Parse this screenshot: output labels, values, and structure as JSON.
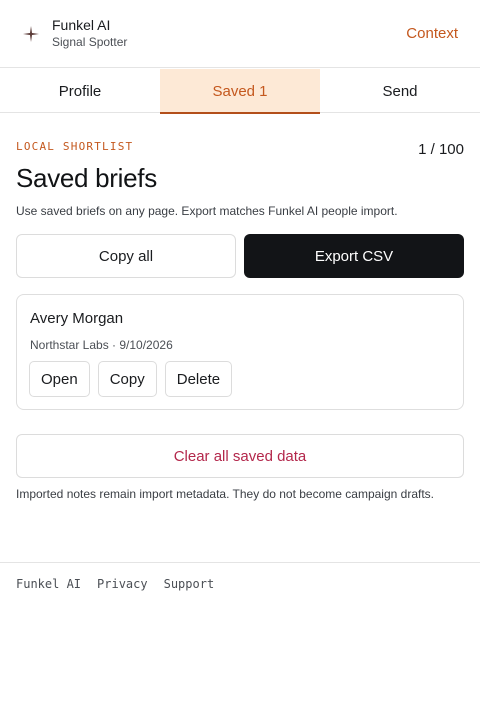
{
  "header": {
    "logo_icon": "sparkle-icon",
    "title": "Funkel AI",
    "subtitle": "Signal Spotter",
    "context_label": "Context",
    "accent_color": "#c4581e"
  },
  "tabs": [
    {
      "label": "Profile",
      "active": false
    },
    {
      "label": "Saved 1",
      "active": true
    },
    {
      "label": "Send",
      "active": false
    }
  ],
  "main": {
    "eyebrow": "LOCAL SHORTLIST",
    "counter": "1 / 100",
    "title": "Saved briefs",
    "description": "Use saved briefs on any page. Export matches Funkel AI people import.",
    "copy_all_label": "Copy all",
    "export_label": "Export CSV",
    "clear_label": "Clear all saved data",
    "note": "Imported notes remain import metadata. They do not become campaign drafts."
  },
  "saved_items": [
    {
      "name": "Avery Morgan",
      "meta": "Northstar Labs · 9/10/2026",
      "actions": [
        "Open",
        "Copy",
        "Delete"
      ]
    }
  ],
  "footer": {
    "links": [
      "Funkel AI",
      "Privacy",
      "Support"
    ]
  }
}
